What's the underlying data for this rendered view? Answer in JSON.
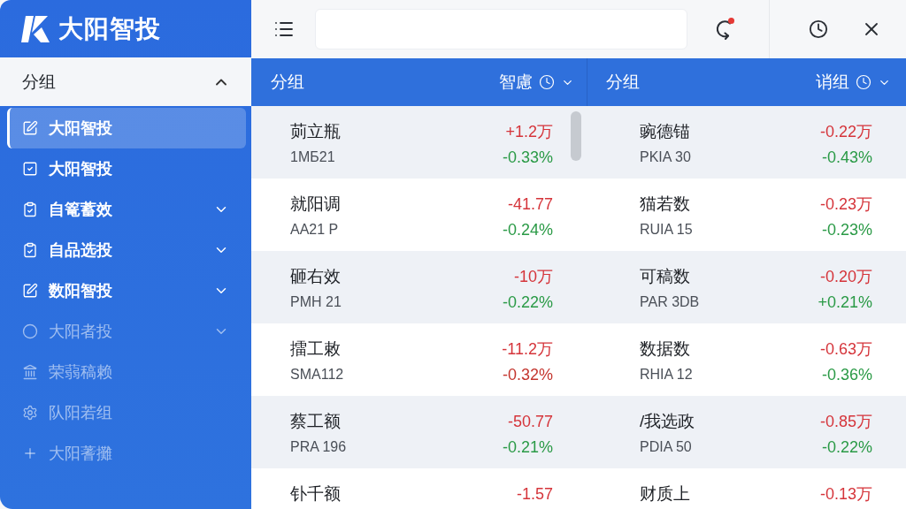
{
  "app": {
    "name": "大阳智投"
  },
  "sidebar": {
    "group": {
      "label": "分组",
      "expanded": true
    },
    "items": [
      {
        "label": "大阳智投",
        "kind": "link",
        "selected": true,
        "disabled": false
      },
      {
        "label": "大阳智投",
        "kind": "link",
        "selected": false,
        "disabled": false
      },
      {
        "label": "自篭蓄效",
        "kind": "group",
        "expanded": false,
        "selected": false,
        "disabled": false
      },
      {
        "label": "自品选投",
        "kind": "group",
        "expanded": false,
        "selected": false,
        "disabled": false
      },
      {
        "label": "数阳智投",
        "kind": "group",
        "expanded": false,
        "selected": false,
        "disabled": false
      },
      {
        "label": "大阳者投",
        "kind": "group",
        "expanded": false,
        "selected": false,
        "disabled": true
      },
      {
        "label": "荣蒻稿赖",
        "kind": "link",
        "selected": false,
        "disabled": true
      },
      {
        "label": "队阳若组",
        "kind": "link",
        "selected": false,
        "disabled": true
      },
      {
        "label": "大阳蓍攤",
        "kind": "link",
        "selected": false,
        "disabled": true
      }
    ]
  },
  "toolbar": {
    "notification": true
  },
  "panes": [
    {
      "header": {
        "title": "分组",
        "filter": "智慮"
      },
      "scrollbar": true,
      "rows": [
        {
          "name": "荝立瓶",
          "code": "1MБ21",
          "value": {
            "text": "+1.2万",
            "color": "#d5343a"
          },
          "change": {
            "text": "-0.33%",
            "color": "#2a9a46"
          }
        },
        {
          "name": "就阳调",
          "code": "AA21 P",
          "value": {
            "text": "-41.77",
            "color": "#d5343a"
          },
          "change": {
            "text": "-0.24%",
            "color": "#2a9a46"
          }
        },
        {
          "name": "砸右效",
          "code": "PMH 21",
          "value": {
            "text": "-10万",
            "color": "#d5343a"
          },
          "change": {
            "text": "-0.22%",
            "color": "#2a9a46"
          }
        },
        {
          "name": "擂工敕",
          "code": "SMA112",
          "value": {
            "text": "-11.2万",
            "color": "#d5343a"
          },
          "change": {
            "text": "-0.32%",
            "color": "#c4362f"
          }
        },
        {
          "name": "蔡工额",
          "code": "PRA 196",
          "value": {
            "text": "-50.77",
            "color": "#d5343a"
          },
          "change": {
            "text": "-0.21%",
            "color": "#2a9a46"
          }
        },
        {
          "name": "钋千额",
          "value": {
            "text": "-1.57",
            "color": "#d5343a"
          }
        }
      ]
    },
    {
      "header": {
        "title": "分组",
        "filter": "诮组"
      },
      "rows": [
        {
          "name": "豌德锚",
          "code": "PKIA 30",
          "value": {
            "text": "-0.22万",
            "color": "#d5343a"
          },
          "change": {
            "text": "-0.43%",
            "color": "#2a9a46"
          }
        },
        {
          "name": "猫若数",
          "code": "RUIA 15",
          "value": {
            "text": "-0.23万",
            "color": "#d5343a"
          },
          "change": {
            "text": "-0.23%",
            "color": "#2a9a46"
          }
        },
        {
          "name": "可稿数",
          "code": "PAR 3DB",
          "value": {
            "text": "-0.20万",
            "color": "#d5343a"
          },
          "change": {
            "text": "+0.21%",
            "color": "#2a9a46"
          }
        },
        {
          "name": "数据数",
          "code": "RHIA 12",
          "value": {
            "text": "-0.63万",
            "color": "#d5343a"
          },
          "change": {
            "text": "-0.36%",
            "color": "#2a9a46"
          }
        },
        {
          "name": "/我选政",
          "code": "PDIA 50",
          "value": {
            "text": "-0.85万",
            "color": "#d5343a"
          },
          "change": {
            "text": "-0.22%",
            "color": "#2a9a46"
          }
        },
        {
          "name": "财质上",
          "value": {
            "text": "-0.13万",
            "color": "#d5343a"
          }
        }
      ]
    }
  ]
}
